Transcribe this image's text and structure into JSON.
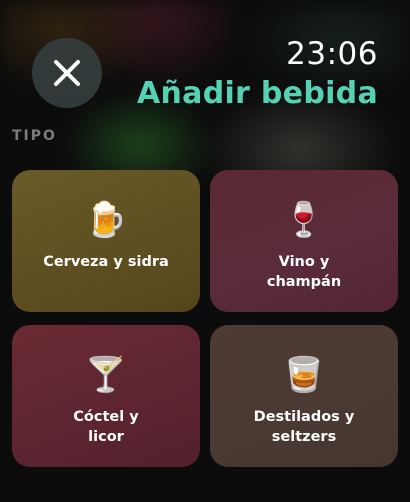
{
  "header": {
    "time": "23:06",
    "title": "Añadir bebida",
    "close_icon": "close-icon",
    "title_color": "#55d2b4"
  },
  "section": {
    "label": "TIPO"
  },
  "drink_types": [
    {
      "line1": "Cerveza y sidra",
      "line2": "",
      "icon": "beer-mug-icon",
      "emoji": "🍺",
      "color": "#62522a"
    },
    {
      "line1": "Vino y",
      "line2": "champán",
      "icon": "wine-glass-icon",
      "emoji": "🍷",
      "color": "#5a2a34"
    },
    {
      "line1": "Cóctel y",
      "line2": "licor",
      "icon": "cocktail-glass-icon",
      "emoji": "🍸",
      "color": "#61262f"
    },
    {
      "line1": "Destilados y",
      "line2": "seltzers",
      "icon": "tumbler-glass-icon",
      "emoji": "🥃",
      "color": "#4b3a33"
    }
  ]
}
